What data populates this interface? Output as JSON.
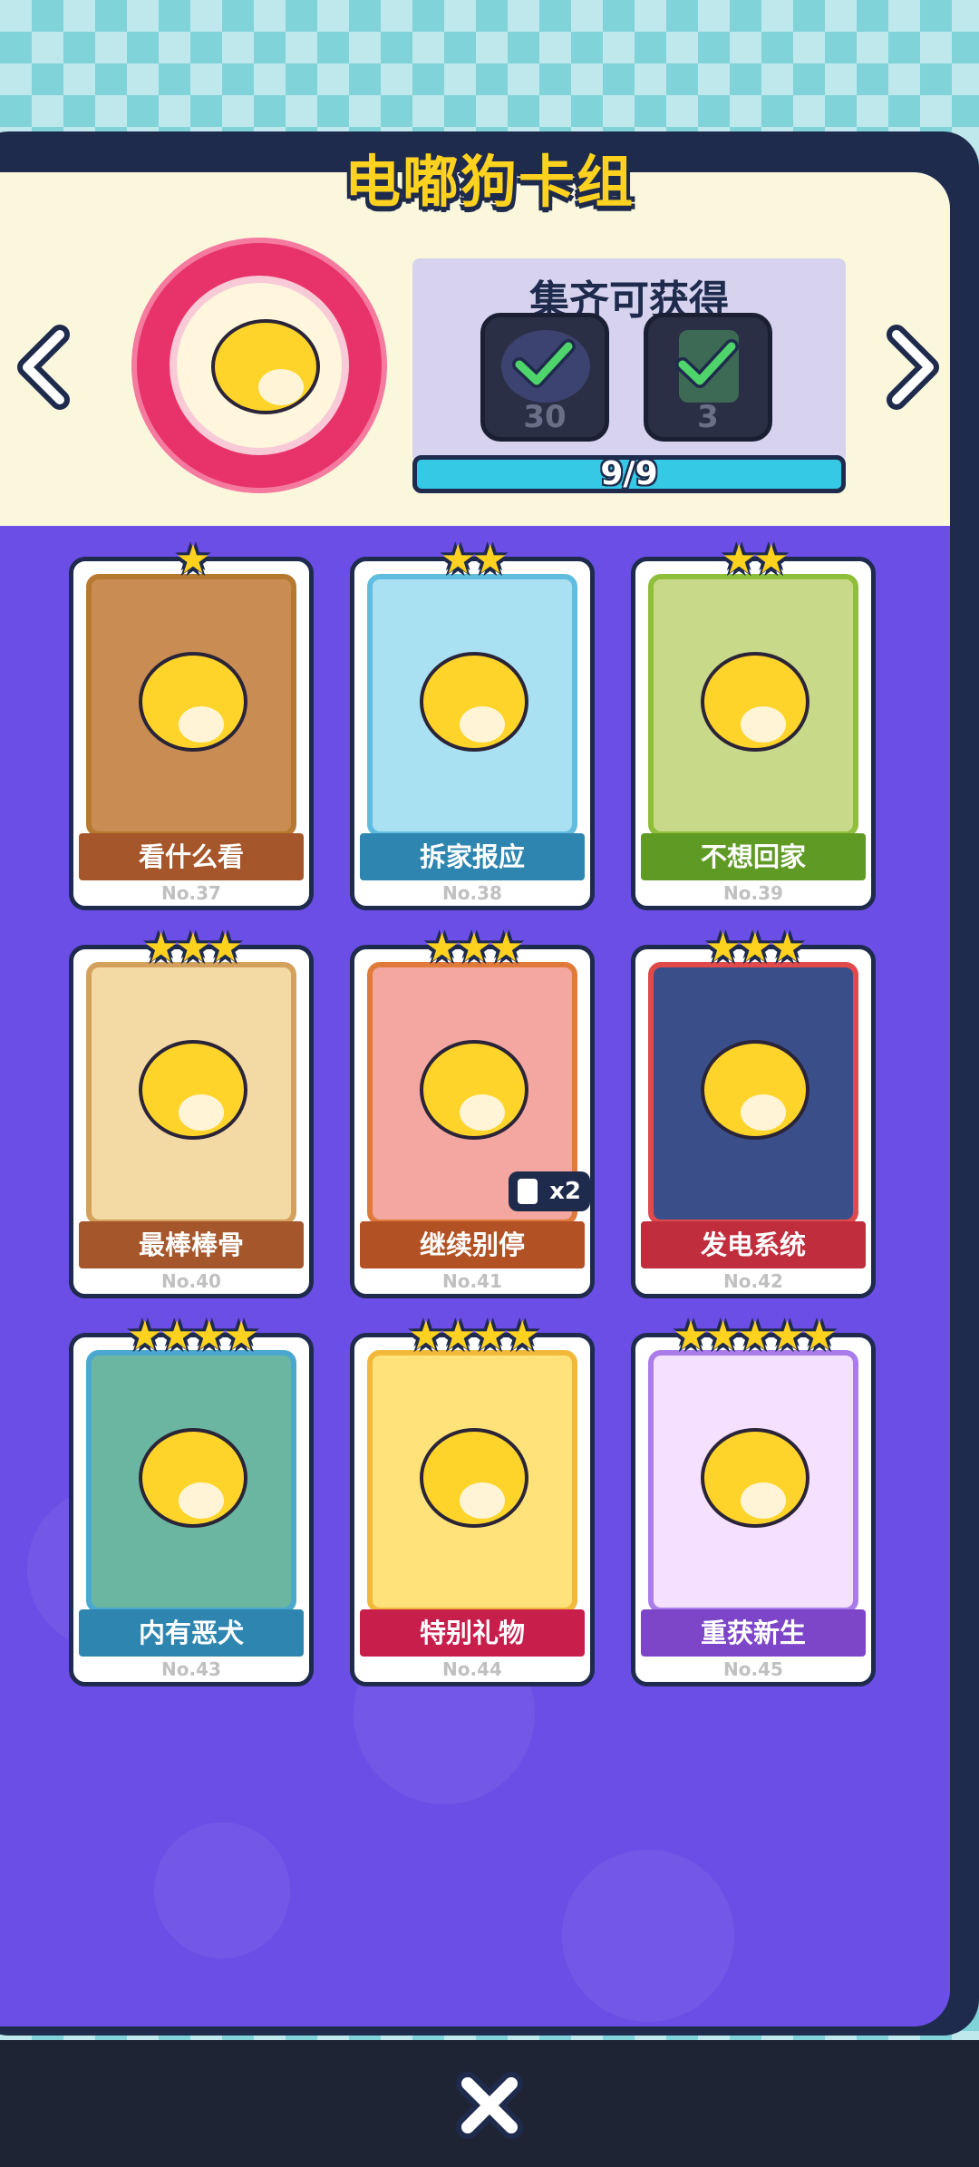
{
  "title": "电嘟狗卡组",
  "reward": {
    "title": "集齐可获得",
    "items": [
      {
        "count": "30",
        "icon": "avatar-frame-icon",
        "claimed": true
      },
      {
        "count": "3",
        "icon": "card-icon",
        "claimed": true
      }
    ],
    "progress": "9/9",
    "progress_fraction": 1.0
  },
  "cards": [
    {
      "name": "看什么看",
      "no": "No.37",
      "stars": "★",
      "ribbon": "#a5562b",
      "bg": "#c98c52",
      "frame": "#b5792f"
    },
    {
      "name": "拆家报应",
      "no": "No.38",
      "stars": "★★",
      "ribbon": "#2e86b0",
      "bg": "#a9e1f2",
      "frame": "#61bde0"
    },
    {
      "name": "不想回家",
      "no": "No.39",
      "stars": "★★",
      "ribbon": "#5f9a25",
      "bg": "#c9d98a",
      "frame": "#8fbf3a"
    },
    {
      "name": "最棒棒骨",
      "no": "No.40",
      "stars": "★★★",
      "ribbon": "#a5562b",
      "bg": "#f3d9a4",
      "frame": "#d4a15c"
    },
    {
      "name": "继续别停",
      "no": "No.41",
      "stars": "★★★",
      "ribbon": "#b25224",
      "bg": "#f4a7a0",
      "frame": "#e07a3a",
      "badge": "x2"
    },
    {
      "name": "发电系统",
      "no": "No.42",
      "stars": "★★★",
      "ribbon": "#c02d3d",
      "bg": "#3a4f8a",
      "frame": "#e04a4a"
    },
    {
      "name": "内有恶犬",
      "no": "No.43",
      "stars": "★★★★",
      "ribbon": "#2e86b0",
      "bg": "#6ab6a0",
      "frame": "#4aa8d0"
    },
    {
      "name": "特别礼物",
      "no": "No.44",
      "stars": "★★★★",
      "ribbon": "#c81e4c",
      "bg": "#ffe37a",
      "frame": "#f2b83a"
    },
    {
      "name": "重获新生",
      "no": "No.45",
      "stars": "★★★★★",
      "ribbon": "#7d45c8",
      "bg": "#f6e0ff",
      "frame": "#a97cea"
    }
  ],
  "nav": {
    "prev_icon": "chevron-left-icon",
    "next_icon": "chevron-right-icon",
    "close_icon": "close-icon"
  },
  "colors": {
    "title": "#ffd21f",
    "panel": "#6b4ee6",
    "outline": "#1f2b4d",
    "progress": "#35c9e6"
  }
}
